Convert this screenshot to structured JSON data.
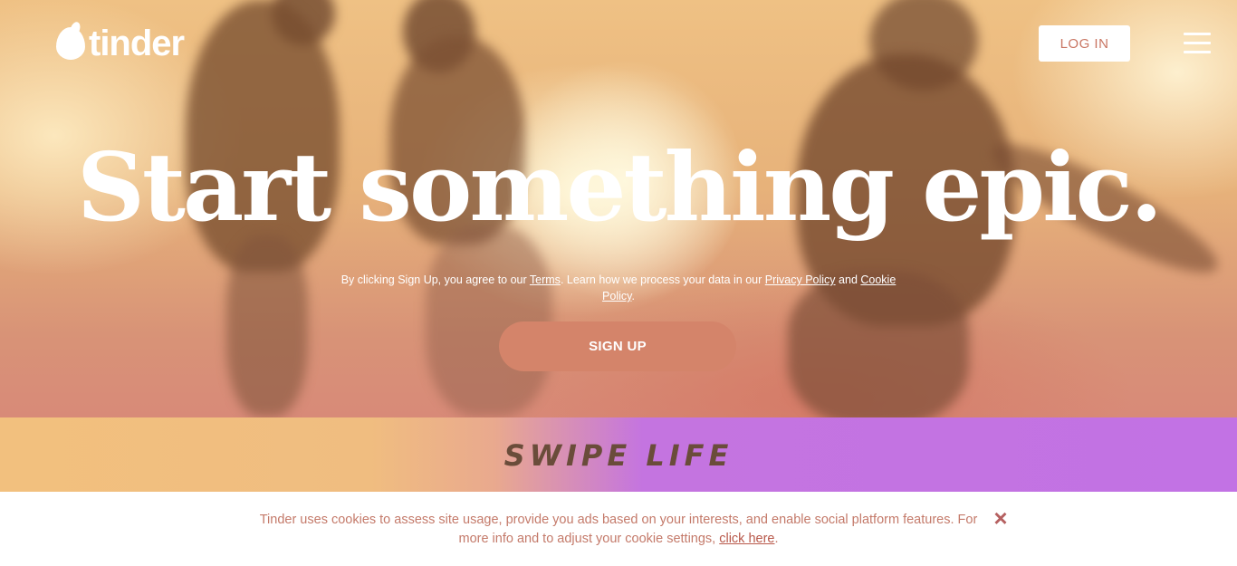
{
  "brand": {
    "logo_text": "tinder"
  },
  "nav": {
    "login_label": "LOG IN",
    "menu_icon": "hamburger-icon"
  },
  "hero": {
    "headline": "Start something epic.",
    "legal": {
      "prefix": "By clicking Sign Up, you agree to our ",
      "terms_link": "Terms",
      "middle": ". Learn how we process your data in our ",
      "privacy_link": "Privacy Policy",
      "and": " and ",
      "cookie_link": "Cookie Policy",
      "suffix": "."
    },
    "signup_label": "SIGN UP"
  },
  "band": {
    "text": "SWIPE LIFE"
  },
  "cookie_bar": {
    "text": "Tinder uses cookies to assess site usage, provide you ads based on your interests, and enable social platform features. For more info and to adjust your cookie settings, ",
    "link": "click here",
    "suffix": ".",
    "close_icon": "close-icon"
  },
  "colors": {
    "accent": "#d4846a",
    "login_text": "#c97663",
    "band_purple": "#c272e4",
    "band_orange": "#f2c07e",
    "cookie_text": "#c47a6a"
  }
}
